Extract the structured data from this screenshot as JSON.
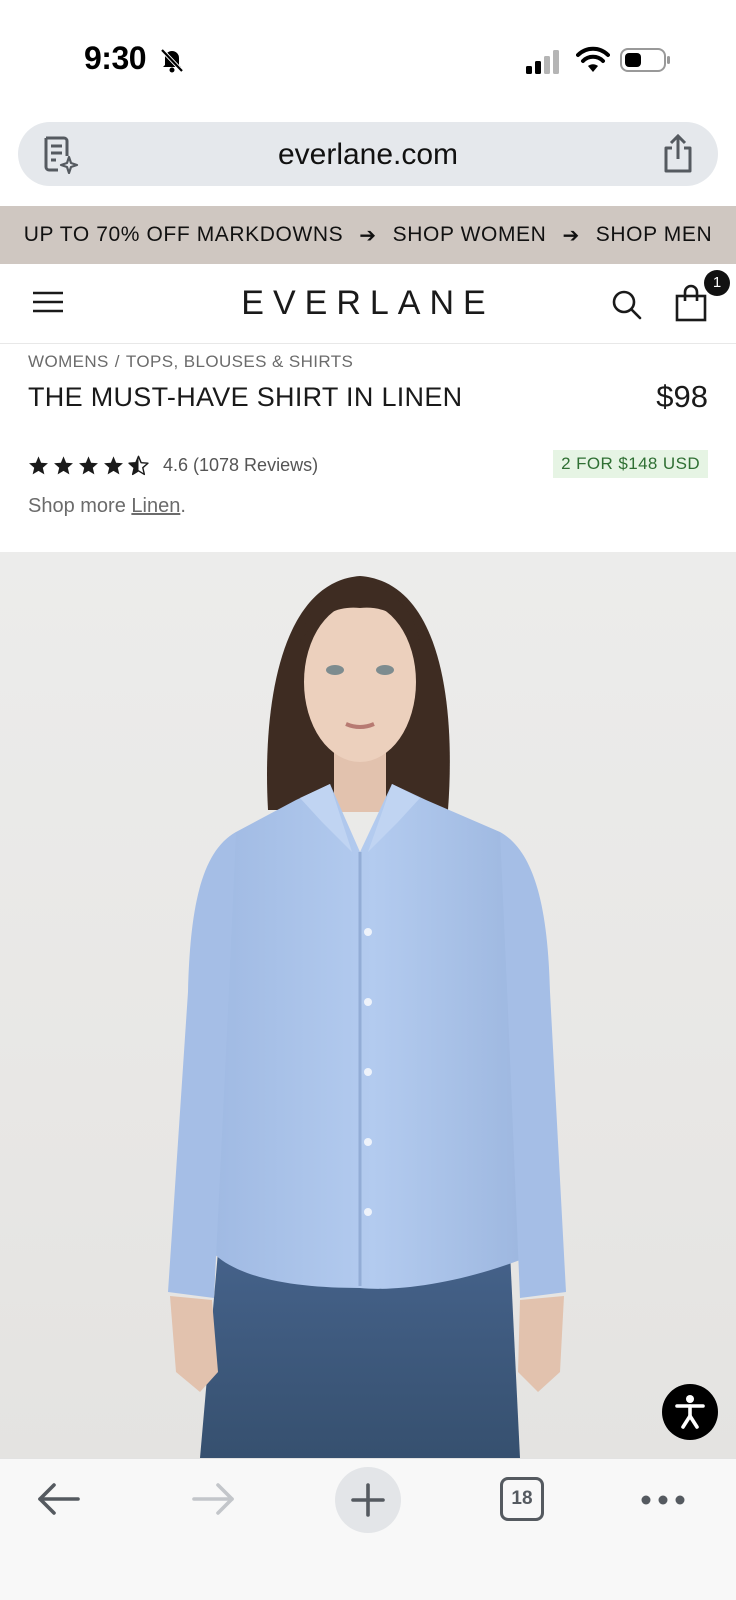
{
  "status_bar": {
    "time": "9:30",
    "icons": [
      "bell-slash-icon",
      "cellular-signal-icon",
      "wifi-icon",
      "battery-icon"
    ]
  },
  "browser": {
    "url": "everlane.com",
    "reader_icon": "reader-mode-icon",
    "share_icon": "share-icon",
    "tab_count": "18",
    "toolbar_icons": [
      "back-arrow-icon",
      "forward-arrow-icon",
      "plus-icon",
      "tabs-icon",
      "more-icon"
    ]
  },
  "promo": {
    "items": [
      "UP TO 70% OFF MARKDOWNS",
      "SHOP WOMEN",
      "SHOP MEN"
    ],
    "background": "#cfc7c1"
  },
  "header": {
    "logo": "EVERLANE",
    "cart_count": "1",
    "icons": [
      "hamburger-menu-icon",
      "search-icon",
      "shopping-bag-icon"
    ]
  },
  "product": {
    "breadcrumb": [
      "WOMENS",
      "TOPS, BLOUSES & SHIRTS"
    ],
    "breadcrumb_separator": "/",
    "title": "THE MUST-HAVE SHIRT IN LINEN",
    "price": "$98",
    "rating_value": 4.6,
    "rating_text": "4.6 (1078 Reviews)",
    "deal": "2 FOR $148 USD",
    "deal_color": "#2f6f33",
    "shop_more_prefix": "Shop more ",
    "shop_more_link": "Linen",
    "shop_more_suffix": ".",
    "image_alt": "model-wearing-light-blue-linen-shirt",
    "shirt_color": "#a9c3ea"
  },
  "accessibility_button_icon": "accessibility-icon"
}
